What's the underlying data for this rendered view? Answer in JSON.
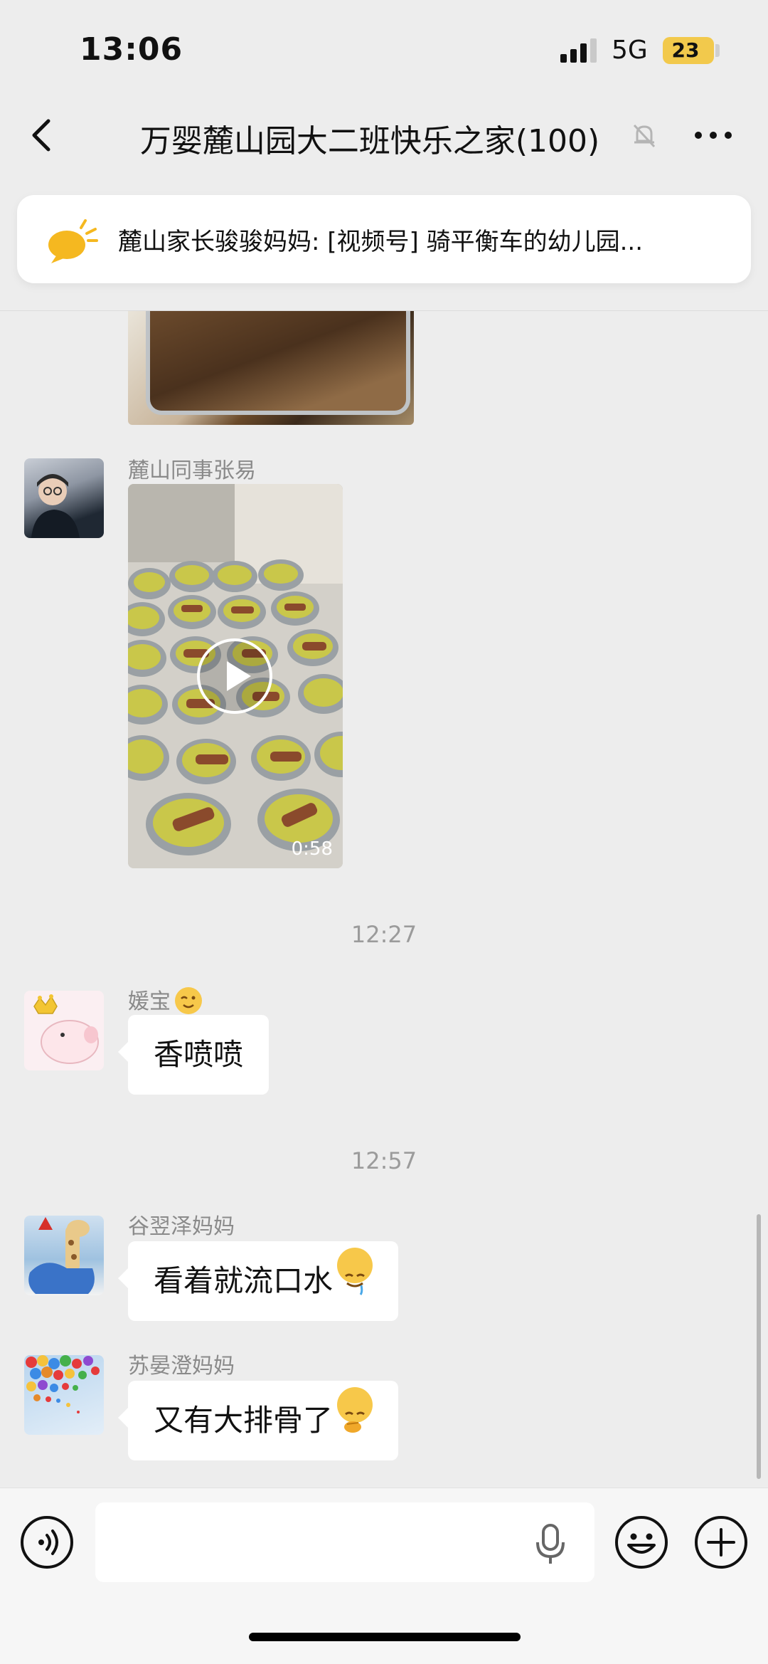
{
  "status_bar": {
    "time": "13:06",
    "network": "5G",
    "battery": "23"
  },
  "header": {
    "title": "万婴麓山园大二班快乐之家(100)"
  },
  "pinned": {
    "text": "麓山家长骏骏妈妈: [视频号] 骑平衡车的幼儿园..."
  },
  "messages": [
    {
      "sender": "麓山同事张易",
      "type": "video",
      "duration": "0:58"
    },
    {
      "timestamp": "12:27"
    },
    {
      "sender": "媛宝",
      "text": "香喷喷"
    },
    {
      "timestamp": "12:57"
    },
    {
      "sender": "谷翌泽妈妈",
      "text": "看着就流口水"
    },
    {
      "sender": "苏晏澄妈妈",
      "text": "又有大排骨了"
    }
  ],
  "icons": {
    "back": "chevron-left-icon",
    "mute": "bell-slash-icon",
    "more": "more-dots-icon",
    "pinned": "speech-burst-icon",
    "play": "play-icon",
    "voice": "voice-icon",
    "mic": "mic-icon",
    "emoji": "emoji-icon",
    "plus": "plus-icon"
  },
  "colors": {
    "background": "#ededed",
    "bubble": "#ffffff",
    "battery": "#f2c94c",
    "pinned_icon": "#f5b820"
  }
}
